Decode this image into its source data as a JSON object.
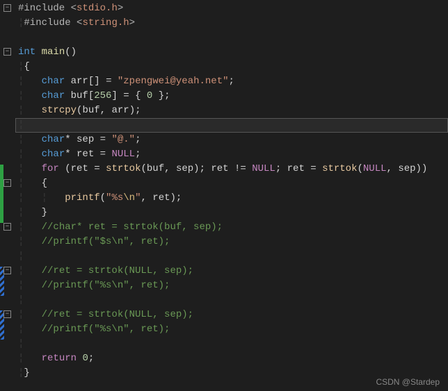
{
  "lines": {
    "l1_pp": "#include",
    "l1_h": "stdio.h",
    "l2_pp": "#include",
    "l2_h": "string.h",
    "l4_type": "int",
    "l4_fn": "main",
    "l6_type": "char",
    "l6_id": "arr",
    "l6_str": "\"zpengwei@yeah.net\"",
    "l7_type": "char",
    "l7_id": "buf",
    "l7_num1": "256",
    "l7_num2": "0",
    "l8_fn": "strcpy",
    "l8_a1": "buf",
    "l8_a2": "arr",
    "l10_type": "char",
    "l10_id": "sep",
    "l10_str": "\"@.\"",
    "l11_type": "char",
    "l11_id": "ret",
    "l11_val": "NULL",
    "l12_for": "for",
    "l12_id1": "ret",
    "l12_fn": "strtok",
    "l12_a1": "buf",
    "l12_a2": "sep",
    "l12_id2": "ret",
    "l12_null": "NULL",
    "l12_id3": "ret",
    "l12_fn2": "strtok",
    "l12_a3": "NULL",
    "l12_a4": "sep",
    "l14_fn": "printf",
    "l14_str1": "\"%s",
    "l14_esc": "\\n",
    "l14_str2": "\"",
    "l14_id": "ret",
    "l16_c": "//char* ret = strtok(buf, sep);",
    "l17_c": "//printf(\"$s\\n\", ret);",
    "l19_c": "//ret = strtok(NULL, sep);",
    "l20_c": "//printf(\"%s\\n\", ret);",
    "l22_c": "//ret = strtok(NULL, sep);",
    "l23_c": "//printf(\"%s\\n\", ret);",
    "l25_kw": "return",
    "l25_num": "0"
  },
  "watermark": "CSDN @Stardep",
  "fold_glyph": "−"
}
